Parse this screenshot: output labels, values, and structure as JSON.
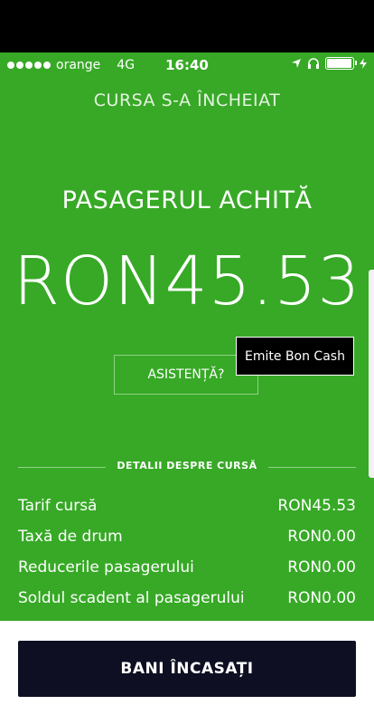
{
  "status_bar": {
    "carrier": "orange",
    "network": "4G",
    "time": "16:40",
    "icons": [
      "location-icon",
      "headphones-icon",
      "battery-icon",
      "charging-icon"
    ]
  },
  "header": {
    "title": "CURSA S-A ÎNCHEIAT"
  },
  "payment": {
    "title": "PASAGERUL ACHITĂ",
    "amount": "RON45.53"
  },
  "assist_button": {
    "label": "ASISTENȚĂ?"
  },
  "tooltip": {
    "label": "Emite Bon Cash"
  },
  "details": {
    "section_title": "DETALII DESPRE CURSĂ",
    "rows": [
      {
        "label": "Tarif cursă",
        "value": "RON45.53"
      },
      {
        "label": "Taxă de drum",
        "value": "RON0.00"
      },
      {
        "label": "Reducerile pasagerului",
        "value": "RON0.00"
      },
      {
        "label": "Soldul scadent al pasagerului",
        "value": "RON0.00"
      }
    ]
  },
  "action": {
    "label": "BANI ÎNCASAȚI"
  },
  "colors": {
    "background": "#37a926",
    "button": "#0e0f22",
    "tooltip": "#000000"
  }
}
